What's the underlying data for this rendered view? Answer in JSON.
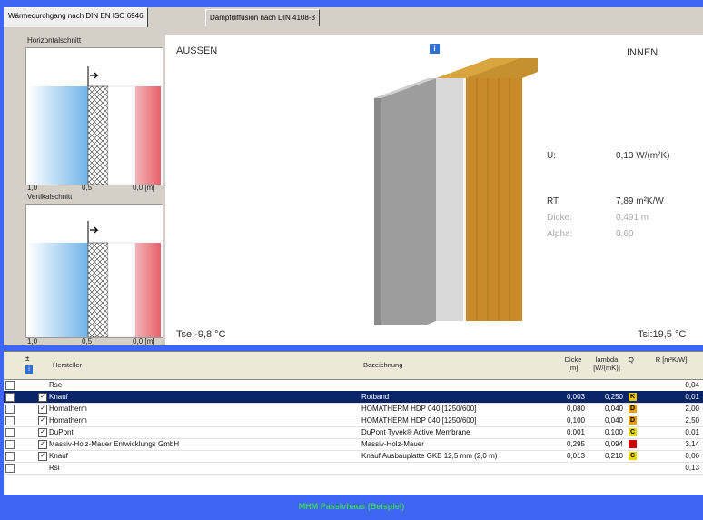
{
  "tabs": [
    "Wärmedurchgang nach DIN EN ISO 6946",
    "Dampfdiffusion nach DIN 4108-3"
  ],
  "side": {
    "horizontal_title": "Horizontalschnitt",
    "vertical_title": "Vertikalschnitt",
    "ticks": [
      "1,0",
      "0,5",
      "0,0 [m]"
    ]
  },
  "canvas": {
    "aussen": "AUSSEN",
    "innen": "INNEN",
    "info_icon": "i",
    "tse": "Tse:-9,8 °C",
    "tsi": "Tsi:19,5 °C",
    "props": [
      {
        "label": "U:",
        "value": "0,13 W/(m²K)",
        "muted": false
      },
      {
        "label": "RT:",
        "value": "7,89 m²K/W",
        "muted": false
      },
      {
        "label": "Dicke:",
        "value": "0,491 m",
        "muted": true
      },
      {
        "label": "Alpha:",
        "value": "0,60",
        "muted": true
      }
    ]
  },
  "table": {
    "headers": {
      "sort": "±",
      "hersteller": "Hersteller",
      "bezeichnung": "Bezeichnung",
      "dicke": "Dicke [m]",
      "lambda": "lambda [W/(mK)]",
      "q": "Q",
      "r": "R [m²K/W]"
    },
    "rows": [
      {
        "checked": false,
        "hersteller": "Rse",
        "bezeichnung": "",
        "dicke": "",
        "lambda": "",
        "q": "",
        "qcolor": "",
        "r": "0,04",
        "selected": false
      },
      {
        "checked": true,
        "hersteller": "Knauf",
        "bezeichnung": "Rotband",
        "dicke": "0,003",
        "lambda": "0,250",
        "q": "K",
        "qcolor": "#e8c800",
        "r": "0,01",
        "selected": true
      },
      {
        "checked": true,
        "hersteller": "Homatherm",
        "bezeichnung": "HOMATHERM HDP 040 [1250/600]",
        "dicke": "0,080",
        "lambda": "0,040",
        "q": "D",
        "qcolor": "#e8a000",
        "r": "2,00",
        "selected": false
      },
      {
        "checked": true,
        "hersteller": "Homatherm",
        "bezeichnung": "HOMATHERM HDP 040 [1250/600]",
        "dicke": "0,100",
        "lambda": "0,040",
        "q": "D",
        "qcolor": "#e8a000",
        "r": "2,50",
        "selected": false
      },
      {
        "checked": true,
        "hersteller": "DuPont",
        "bezeichnung": "DuPont Tyvek® Active Membrane",
        "dicke": "0,001",
        "lambda": "0,100",
        "q": "C",
        "qcolor": "#e8d800",
        "r": "0,01",
        "selected": false
      },
      {
        "checked": true,
        "hersteller": "Massiv-Holz-Mauer Entwicklungs GmbH",
        "bezeichnung": "Massiv-Holz-Mauer",
        "dicke": "0,295",
        "lambda": "0,094",
        "q": "",
        "qcolor": "#cc0000",
        "r": "3,14",
        "selected": false
      },
      {
        "checked": true,
        "hersteller": "Knauf",
        "bezeichnung": "Knauf Ausbauplatte GKB 12,5 mm (2,0 m)",
        "dicke": "0,013",
        "lambda": "0,210",
        "q": "C",
        "qcolor": "#e8d800",
        "r": "0,06",
        "selected": false
      },
      {
        "checked": false,
        "hersteller": "Rsi",
        "bezeichnung": "",
        "dicke": "",
        "lambda": "",
        "q": "",
        "qcolor": "",
        "r": "0,13",
        "selected": false
      }
    ]
  },
  "footer": {
    "caption": "MHM Passivhaus (Beispiel)"
  },
  "colors": {
    "background": "#3f65f4",
    "selection": "#0a246a",
    "wood": "#c98a2a",
    "insulation": "#d9a53f"
  }
}
